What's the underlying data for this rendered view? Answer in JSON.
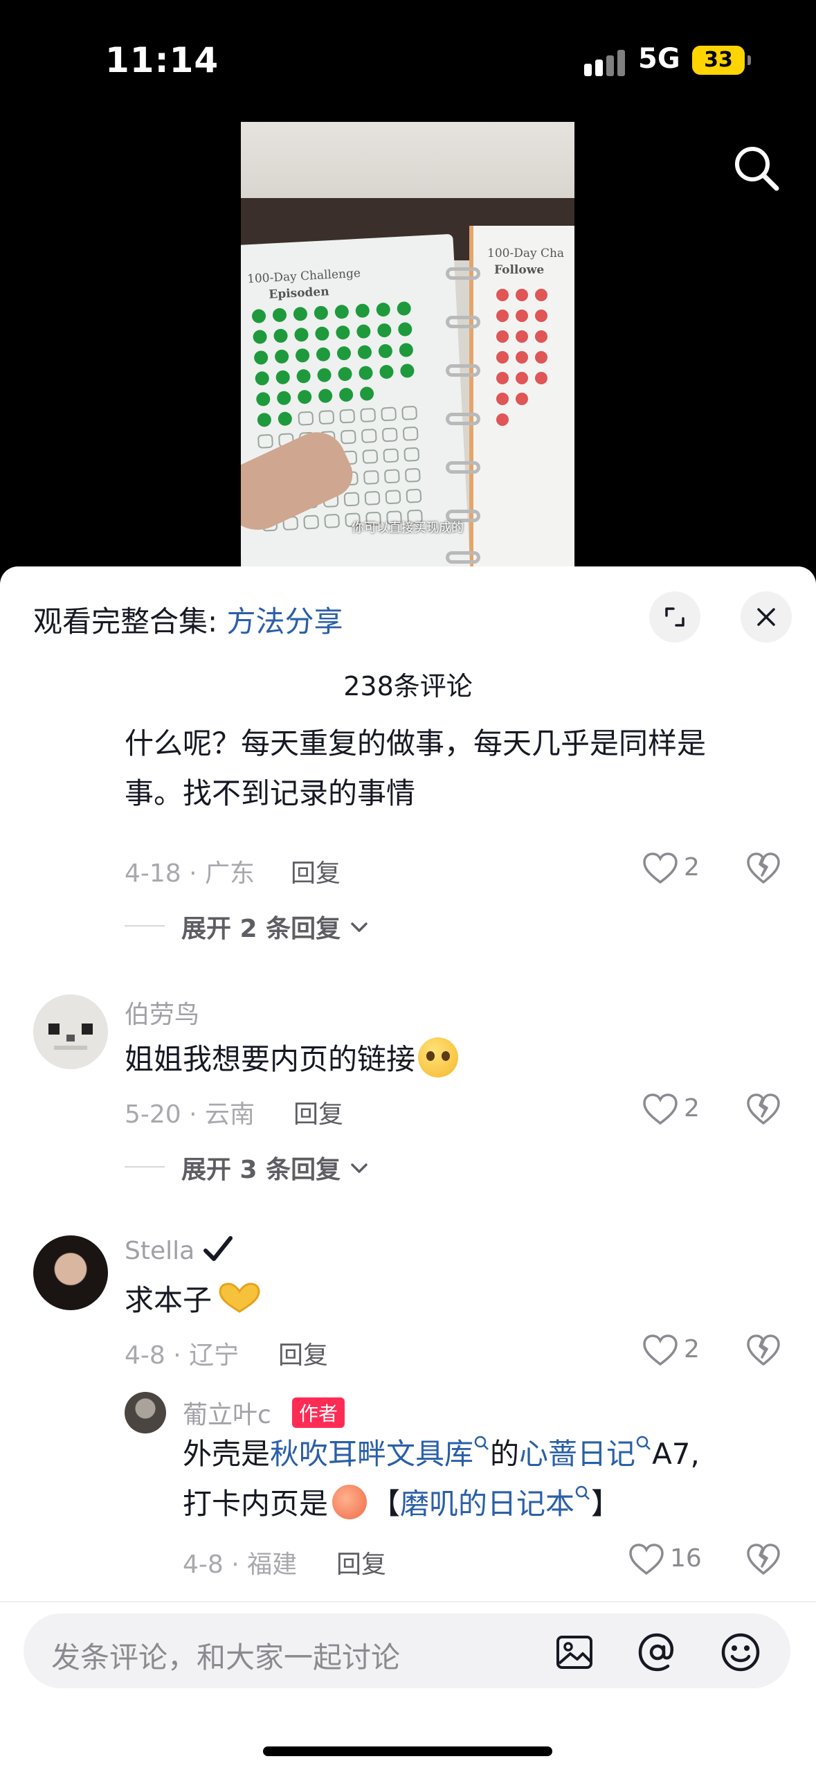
{
  "status_bar": {
    "time": "11:14",
    "network": "5G",
    "battery": "33"
  },
  "video": {
    "subtitle": "你可以直接买现成的",
    "page_left_title": "100-Day Challenge",
    "page_left_goal": "Episoden",
    "page_right_title": "100-Day Cha",
    "page_right_goal": "Followe"
  },
  "sheet": {
    "collection_prefix": "观看完整合集: ",
    "collection_link": "方法分享",
    "comment_count": "238条评论"
  },
  "comments": [
    {
      "text_line1": "什么呢？每天重复的做事，每天几乎是同样是",
      "text_line2": "事。找不到记录的事情",
      "meta": "4-18 · 广东",
      "reply": "回复",
      "likes": "2",
      "expand": "展开 2 条回复"
    },
    {
      "username": "伯劳鸟",
      "text": "姐姐我想要内页的链接",
      "meta": "5-20 · 云南",
      "reply": "回复",
      "likes": "2",
      "expand": "展开 3 条回复"
    },
    {
      "username": "Stella",
      "text": "求本子",
      "meta": "4-8 · 辽宁",
      "reply": "回复",
      "likes": "2"
    }
  ],
  "author_reply": {
    "username": "葡立叶c",
    "badge": "作者",
    "p1": "外壳是",
    "kw1": "秋吹耳畔文具库",
    "p2": "的",
    "kw2": "心蔷日记",
    "p3": "A7,",
    "p4": "打卡内页是",
    "p5": "【",
    "kw3": "磨叽的日记本",
    "p6": "】",
    "meta": "4-8 · 福建",
    "reply": "回复",
    "likes": "16"
  },
  "input": {
    "placeholder": "发条评论，和大家一起讨论"
  },
  "colors": {
    "link": "#2a5fa8",
    "author_badge": "#fe2c55",
    "battery": "#ffd400"
  }
}
